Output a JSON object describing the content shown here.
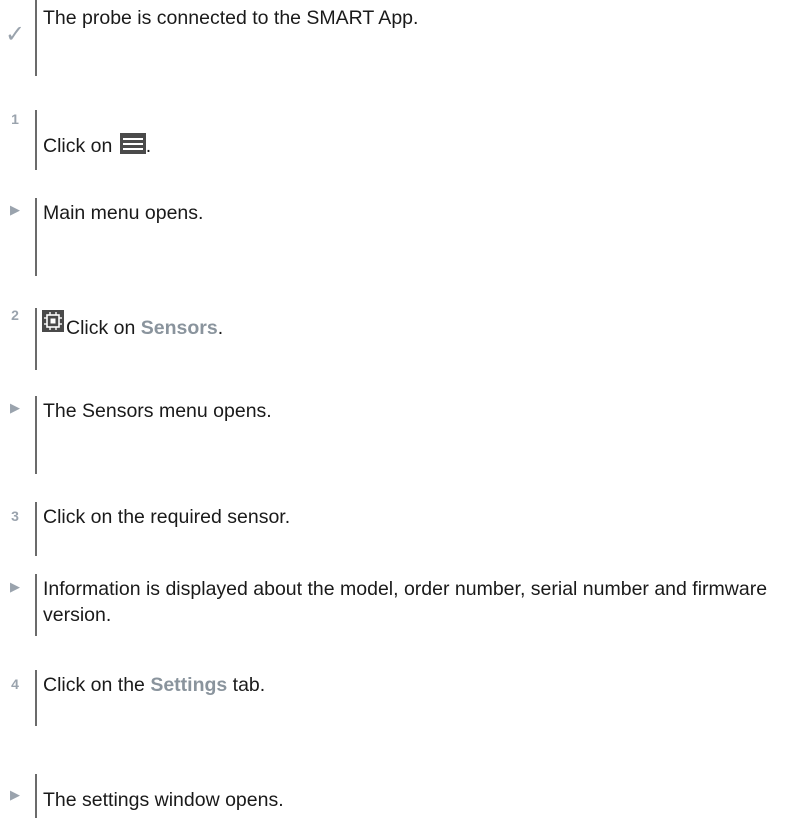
{
  "markers": {
    "check": "✓",
    "result": "▶",
    "step1": "1",
    "step2": "2",
    "step3": "3",
    "step4": "4"
  },
  "lines": {
    "precondition": "The probe is connected to the SMART App.",
    "step1_text": "Click on ",
    "step1_after": ".",
    "result1": "Main menu opens.",
    "step2_text": " Click on ",
    "step2_keyword": "Sensors",
    "step2_after": ".",
    "result2": "The Sensors menu opens.",
    "step3_text": "Click on the required sensor.",
    "result3": "Information is displayed about the model, order number, serial number and firmware version.",
    "step4_text": "Click on the ",
    "step4_keyword": "Settings",
    "step4_after": " tab.",
    "result4": "The settings window opens."
  },
  "icons": {
    "menu": "hamburger-menu-icon",
    "sensors": "sensor-chip-icon"
  },
  "colors": {
    "keyword": "#8a949d",
    "marker": "#9aa3ad",
    "bar": "#6b6b6b",
    "icon": "#4a4a4a"
  }
}
